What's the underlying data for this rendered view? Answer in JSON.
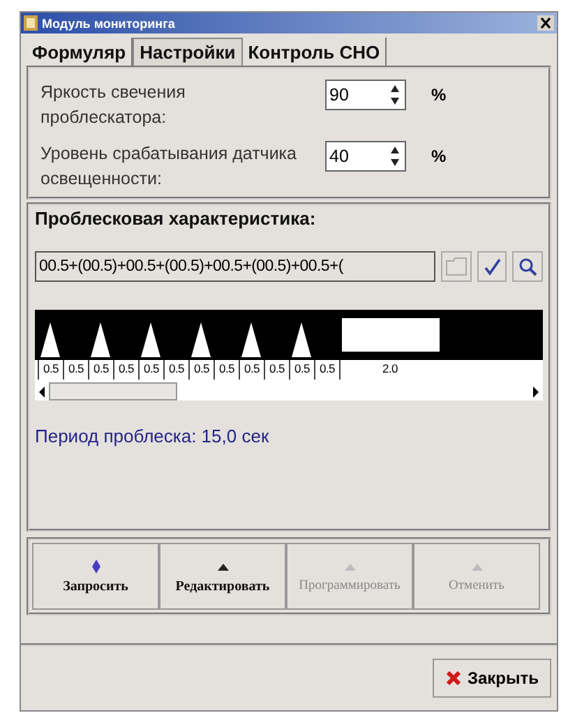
{
  "window": {
    "title": "Модуль мониторинга"
  },
  "tabs": [
    {
      "label": "Формуляр",
      "selected": false
    },
    {
      "label": "Настройки",
      "selected": true
    },
    {
      "label": "Контроль СНО",
      "selected": false
    }
  ],
  "settings": [
    {
      "label": "Яркость свечения проблескатора:",
      "value": "90",
      "unit": "%"
    },
    {
      "label": "Уровень срабатывания датчика освещенности:",
      "value": "40",
      "unit": "%"
    }
  ],
  "flash_section": {
    "title": "Проблесковая характеристика:",
    "formula": "00.5+(00.5)+00.5+(00.5)+00.5+(00.5)+00.5+(",
    "segments": [
      {
        "kind": "flash",
        "label": "0.5"
      },
      {
        "kind": "dark",
        "label": "0.5"
      },
      {
        "kind": "flash",
        "label": "0.5"
      },
      {
        "kind": "dark",
        "label": "0.5"
      },
      {
        "kind": "flash",
        "label": "0.5"
      },
      {
        "kind": "dark",
        "label": "0.5"
      },
      {
        "kind": "flash",
        "label": "0.5"
      },
      {
        "kind": "dark",
        "label": "0.5"
      },
      {
        "kind": "flash",
        "label": "0.5"
      },
      {
        "kind": "dark",
        "label": "0.5"
      },
      {
        "kind": "flash",
        "label": "0.5"
      },
      {
        "kind": "dark",
        "label": "0.5"
      },
      {
        "kind": "long",
        "label": "2.0"
      }
    ],
    "period": "Период проблеска: 15,0 сек"
  },
  "actions": [
    {
      "label": "Запросить",
      "disabled": false
    },
    {
      "label": "Редактировать",
      "disabled": false
    },
    {
      "label": "Программировать",
      "disabled": true
    },
    {
      "label": "Отменить",
      "disabled": true
    }
  ],
  "close_button": {
    "label": "Закрыть"
  }
}
